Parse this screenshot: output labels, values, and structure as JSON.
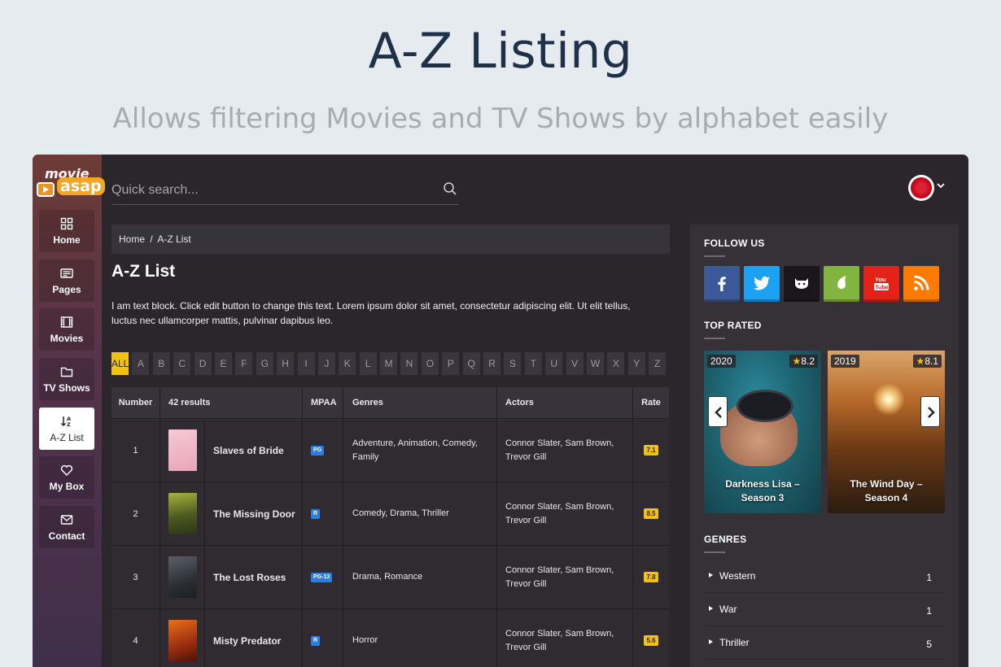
{
  "promo": {
    "title": "A-Z Listing",
    "subtitle": "Allows filtering Movies and TV Shows by alphabet easily"
  },
  "logo": {
    "line1": "movie",
    "line2": "asap"
  },
  "sidebar": {
    "items": [
      {
        "label": "Home",
        "icon": "grid-icon"
      },
      {
        "label": "Pages",
        "icon": "pages-icon"
      },
      {
        "label": "Movies",
        "icon": "film-icon"
      },
      {
        "label": "TV Shows",
        "icon": "folder-icon"
      },
      {
        "label": "A-Z List",
        "icon": "sort-az-icon",
        "active": true
      },
      {
        "label": "My Box",
        "icon": "heart-icon"
      },
      {
        "label": "Contact",
        "icon": "mail-icon"
      }
    ]
  },
  "search": {
    "placeholder": "Quick search..."
  },
  "breadcrumb": {
    "home": "Home",
    "separator": "/",
    "current": "A-Z List"
  },
  "page": {
    "title": "A-Z List",
    "text": "I am text block. Click edit button to change this text. Lorem ipsum dolor sit amet, consectetur adipiscing elit. Ut elit tellus, luctus nec ullamcorper mattis, pulvinar dapibus leo."
  },
  "alphabet": [
    "ALL",
    "A",
    "B",
    "C",
    "D",
    "E",
    "F",
    "G",
    "H",
    "I",
    "J",
    "K",
    "L",
    "M",
    "N",
    "O",
    "P",
    "Q",
    "R",
    "S",
    "T",
    "U",
    "V",
    "W",
    "X",
    "Y",
    "Z"
  ],
  "table": {
    "headers": {
      "number": "Number",
      "results": "42 results",
      "mpaa": "MPAA",
      "genres": "Genres",
      "actors": "Actors",
      "rate": "Rate"
    },
    "rows": [
      {
        "number": "1",
        "title": "Slaves of Bride",
        "mpaa": "PG",
        "genres": "Adventure, Animation, Comedy, Family",
        "actors": "Connor Slater, Sam Brown, Trevor Gill",
        "rate": "7.1"
      },
      {
        "number": "2",
        "title": "The Missing Door",
        "mpaa": "R",
        "genres": "Comedy, Drama, Thriller",
        "actors": "Connor Slater, Sam Brown, Trevor Gill",
        "rate": "8.5"
      },
      {
        "number": "3",
        "title": "The Lost Roses",
        "mpaa": "PG-13",
        "genres": "Drama, Romance",
        "actors": "Connor Slater, Sam Brown, Trevor Gill",
        "rate": "7.8"
      },
      {
        "number": "4",
        "title": "Misty Predator",
        "mpaa": "R",
        "genres": "Horror",
        "actors": "Connor Slater, Sam Brown, Trevor Gill",
        "rate": "5.6"
      }
    ]
  },
  "follow": {
    "title": "FOLLOW US",
    "networks": [
      {
        "name": "facebook",
        "color": "#3b5998"
      },
      {
        "name": "twitter",
        "color": "#1da1f2"
      },
      {
        "name": "github",
        "color": "#1a171b"
      },
      {
        "name": "envato",
        "color": "#82b440"
      },
      {
        "name": "youtube",
        "color": "#e62117"
      },
      {
        "name": "rss",
        "color": "#ff7a00"
      }
    ]
  },
  "top_rated": {
    "title": "TOP RATED",
    "cards": [
      {
        "year": "2020",
        "score": "8.2",
        "title": "Darkness Lisa – Season 3"
      },
      {
        "year": "2019",
        "score": "8.1",
        "title": "The Wind Day – Season 4"
      }
    ]
  },
  "genres": {
    "title": "GENRES",
    "items": [
      {
        "name": "Western",
        "count": "1"
      },
      {
        "name": "War",
        "count": "1"
      },
      {
        "name": "Thriller",
        "count": "5"
      }
    ]
  }
}
